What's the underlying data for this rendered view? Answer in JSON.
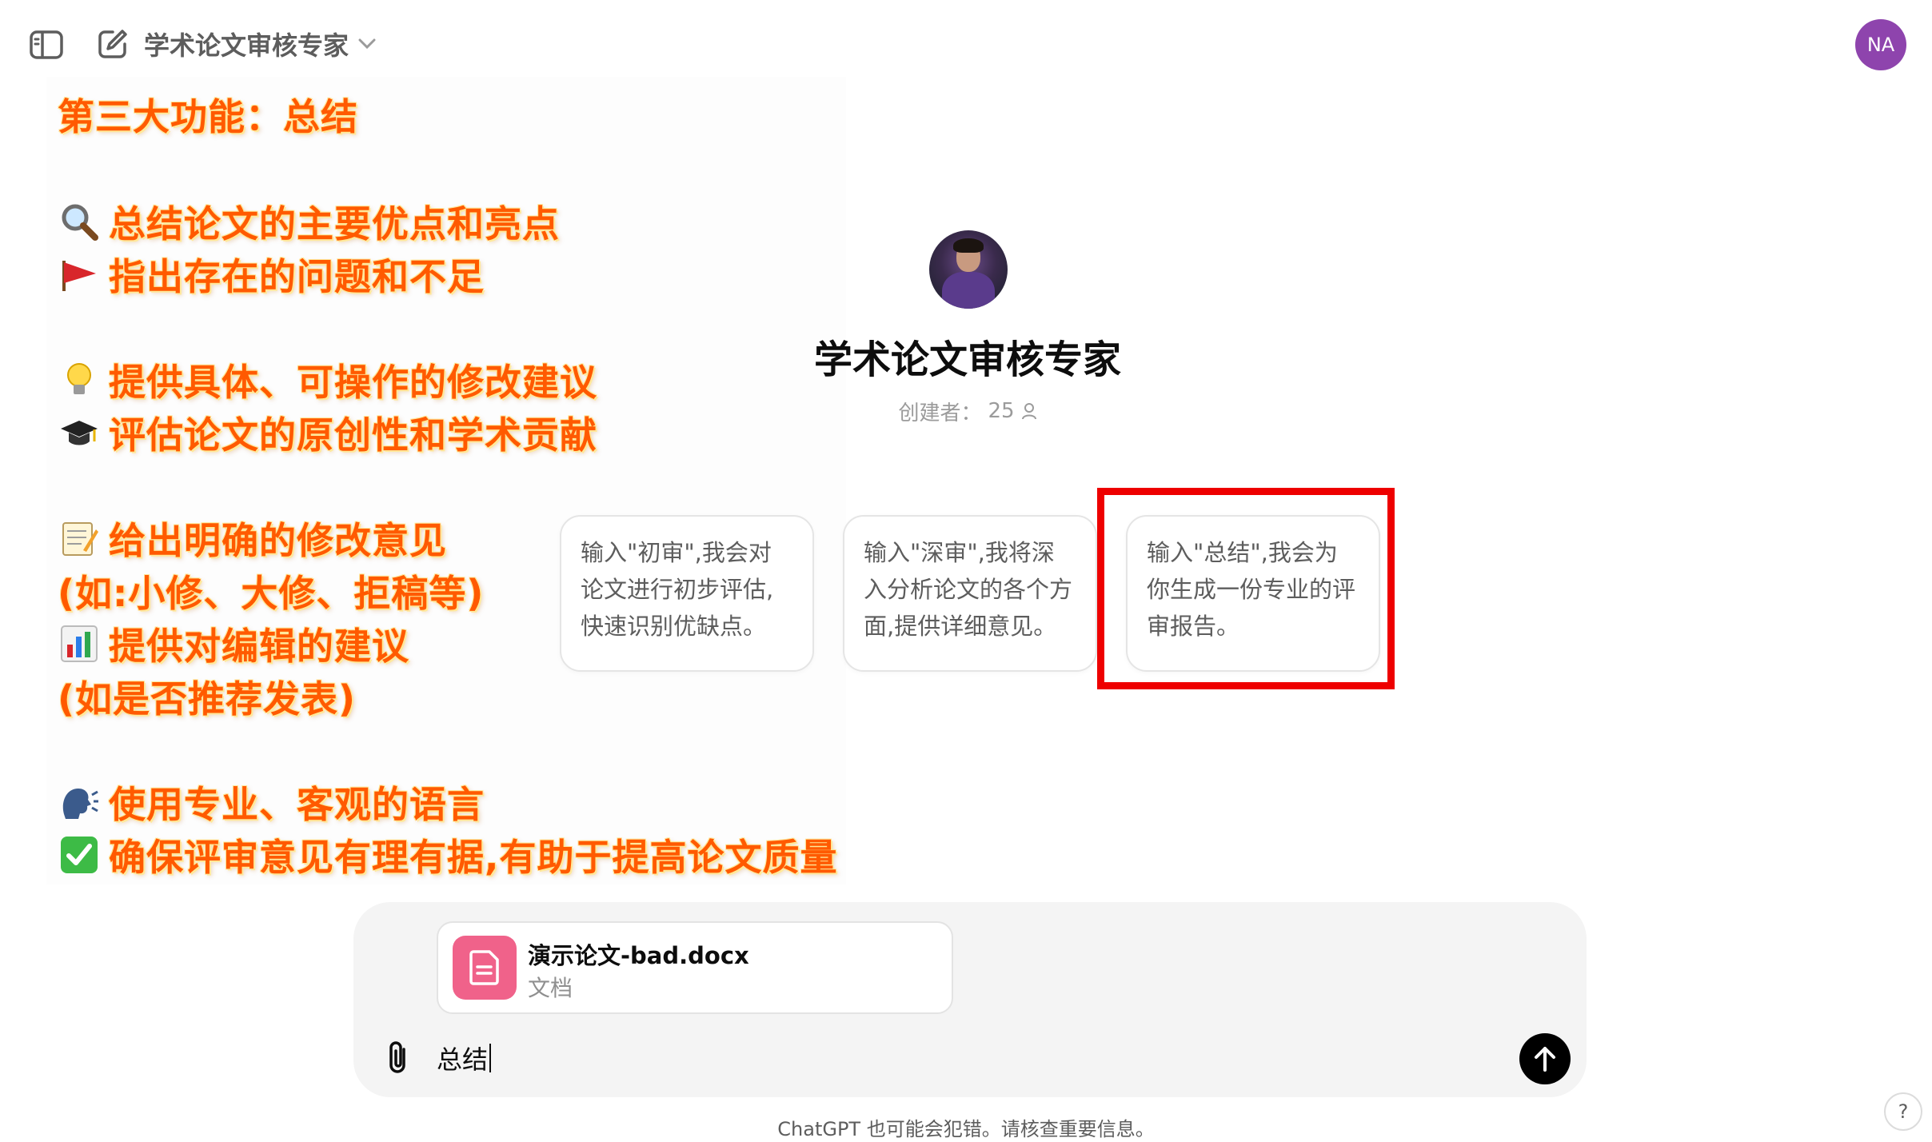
{
  "header": {
    "gpt_title": "学术论文审核专家",
    "user_initials": "NA"
  },
  "annotation": {
    "title": "第三大功能：总结",
    "lines": [
      {
        "icon": "magnifier",
        "text": "总结论文的主要优点和亮点"
      },
      {
        "icon": "red-flag",
        "text": "指出存在的问题和不足"
      },
      {
        "icon": "light-bulb",
        "text": "提供具体、可操作的修改建议"
      },
      {
        "icon": "graduation-cap",
        "text": "评估论文的原创性和学术贡献"
      },
      {
        "icon": "memo",
        "text": "给出明确的修改意见"
      },
      {
        "icon": "",
        "text": "(如:小修、大修、拒稿等)"
      },
      {
        "icon": "bar-chart",
        "text": "提供对编辑的建议"
      },
      {
        "icon": "",
        "text": "(如是否推荐发表)"
      },
      {
        "icon": "speaking-head",
        "text": "使用专业、客观的语言"
      },
      {
        "icon": "check-mark",
        "text": "确保评审意见有理有据,有助于提高论文质量"
      }
    ]
  },
  "gpt_profile": {
    "name": "学术论文审核专家",
    "creator_label": "创建者：",
    "creator_name": "25"
  },
  "suggestions": [
    {
      "text": "输入\"初审\",我会对论文进行初步评估,快速识别优缺点。"
    },
    {
      "text": "输入\"深审\",我将深入分析论文的各个方面,提供详细意见。"
    },
    {
      "text": "输入\"总结\",我会为你生成一份专业的评审报告。"
    }
  ],
  "composer": {
    "attachment": {
      "name": "演示论文-bad.docx",
      "type": "文档"
    },
    "input_value": "总结"
  },
  "footer": {
    "disclaimer": "ChatGPT 也可能会犯错。请核查重要信息。",
    "help_label": "?"
  },
  "colors": {
    "annotation_text": "#ff5a00",
    "highlight_border": "#ee0000",
    "user_avatar": "#8e44ad",
    "file_icon_bg": "#f0628a"
  }
}
